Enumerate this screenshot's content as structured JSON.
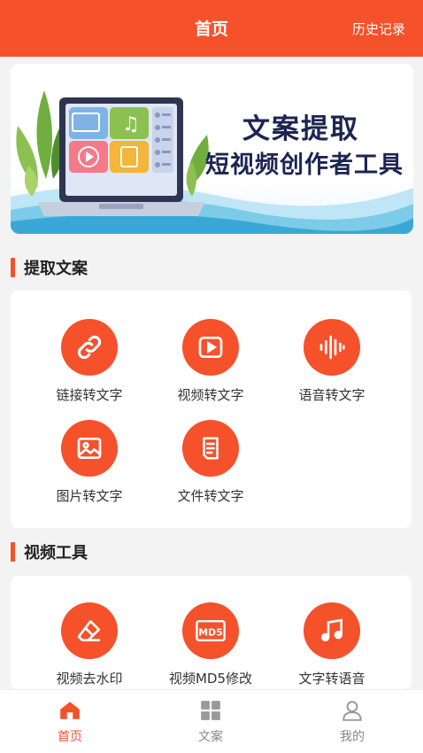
{
  "header": {
    "title": "首页",
    "history": "历史记录"
  },
  "banner": {
    "line1": "文案提取",
    "line2": "短视频创作者工具"
  },
  "sections": [
    {
      "title": "提取文案",
      "items": [
        {
          "label": "链接转文字",
          "icon": "link-icon"
        },
        {
          "label": "视频转文字",
          "icon": "video-play-icon"
        },
        {
          "label": "语音转文字",
          "icon": "audio-wave-icon"
        },
        {
          "label": "图片转文字",
          "icon": "image-icon"
        },
        {
          "label": "文件转文字",
          "icon": "document-icon"
        }
      ]
    },
    {
      "title": "视频工具",
      "items": [
        {
          "label": "视频去水印",
          "icon": "eraser-icon"
        },
        {
          "label": "视频MD5修改",
          "icon": "md5-icon"
        },
        {
          "label": "文字转语音",
          "icon": "music-note-icon"
        }
      ]
    }
  ],
  "tabbar": [
    {
      "label": "首页",
      "icon": "home-icon",
      "active": true
    },
    {
      "label": "文案",
      "icon": "grid-icon",
      "active": false
    },
    {
      "label": "我的",
      "icon": "user-icon",
      "active": false
    }
  ],
  "colors": {
    "accent": "#f5512b",
    "background": "#f3f3f3",
    "card": "#ffffff",
    "inactive": "#888888"
  }
}
